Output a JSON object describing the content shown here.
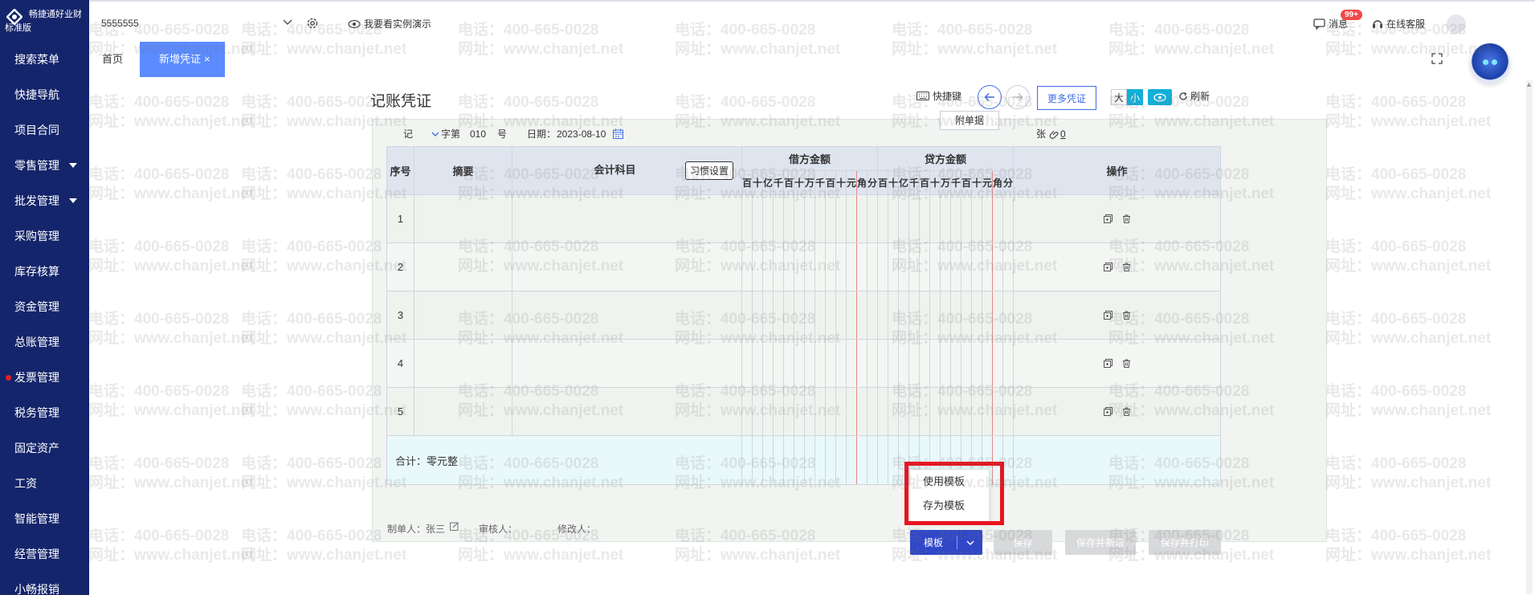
{
  "sidebar": {
    "brand_line1": "畅捷通好业财",
    "brand_line2": "标准版",
    "items": [
      {
        "label": "搜索菜单"
      },
      {
        "label": "快捷导航"
      },
      {
        "label": "项目合同"
      },
      {
        "label": "零售管理"
      },
      {
        "label": "批发管理"
      },
      {
        "label": "采购管理"
      },
      {
        "label": "库存核算"
      },
      {
        "label": "资金管理"
      },
      {
        "label": "总账管理"
      },
      {
        "label": "发票管理"
      },
      {
        "label": "税务管理"
      },
      {
        "label": "固定资产"
      },
      {
        "label": "工资"
      },
      {
        "label": "智能管理"
      },
      {
        "label": "经营管理"
      },
      {
        "label": "小畅报销"
      }
    ]
  },
  "header": {
    "account_value": "5555555",
    "demo_link": "我要看实例演示",
    "messages_label": "消息",
    "messages_badge": "99+",
    "service_label": "在线客服"
  },
  "tabs": [
    {
      "label": "首页"
    },
    {
      "label": "新增凭证"
    }
  ],
  "watermark": {
    "phone": "电话：400-665-0028",
    "website": "网址：www.chanjet.net"
  },
  "toolbar": {
    "title": "记账凭证",
    "shortcut": "快捷键",
    "more_vouchers": "更多凭证",
    "size_large": "大",
    "size_small": "小",
    "refresh": "刷新"
  },
  "voucher": {
    "type": "记",
    "word_label": "字第",
    "number": "010",
    "number_suffix": "号",
    "date_label": "日期：",
    "date": "2023-08-10",
    "attach_button": "附单据",
    "sheets_label": "张",
    "attachment_count": "0"
  },
  "table": {
    "col_seq": "序号",
    "col_summary": "摘要",
    "col_account": "会计科目",
    "habit_button": "习惯设置",
    "col_debit": "借方金额",
    "col_credit": "贷方金额",
    "col_ops": "操作",
    "digits": [
      "百",
      "十",
      "亿",
      "千",
      "百",
      "十",
      "万",
      "千",
      "百",
      "十",
      "元",
      "角",
      "分"
    ],
    "rows": [
      "1",
      "2",
      "3",
      "4",
      "5"
    ],
    "total_label": "合计：零元整"
  },
  "footer": {
    "maker_label": "制单人：张三",
    "auditor_label": "审核人：",
    "modifier_label": "修改人：",
    "template_button": "模板",
    "save_button": "保存",
    "save_new_button": "保存并新增",
    "save_print_button": "保存并打印"
  },
  "template_menu": {
    "use": "使用模板",
    "save_as": "存为模板"
  },
  "colors": {
    "sidebar": "#15256b",
    "accent": "#3d6fe8",
    "tab_active": "#5b8bff",
    "highlight": "#e8141e"
  }
}
